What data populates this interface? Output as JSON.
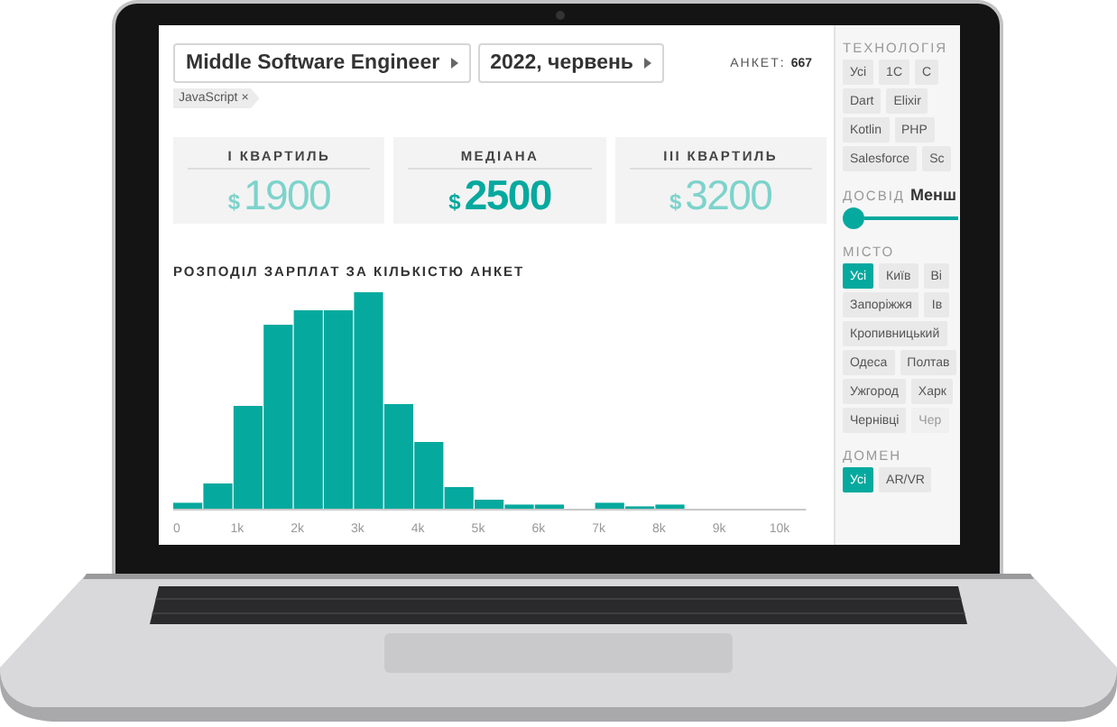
{
  "filters": [
    {
      "label": "Middle Software Engineer"
    },
    {
      "label": "2022, червень"
    }
  ],
  "count": {
    "label": "АНКЕТ:",
    "value": "667"
  },
  "tags": [
    {
      "label": "JavaScript",
      "remove": "×"
    }
  ],
  "stats": [
    {
      "label": "I КВАРТИЛЬ",
      "currency": "$",
      "value": "1900",
      "highlight": false
    },
    {
      "label": "МЕДІАНА",
      "currency": "$",
      "value": "2500",
      "highlight": true
    },
    {
      "label": "III КВАРТИЛЬ",
      "currency": "$",
      "value": "3200",
      "highlight": false
    }
  ],
  "chart": {
    "title": "РОЗПОДІЛ ЗАРПЛАТ ЗА КІЛЬКІСТЮ АНКЕТ",
    "x_ticks": [
      "0",
      "1k",
      "2k",
      "3k",
      "4k",
      "5k",
      "6k",
      "7k",
      "8k",
      "9k",
      "10k"
    ]
  },
  "sidebar": {
    "sections": [
      {
        "kind": "chips",
        "title": "ТЕХНОЛОГІЯ",
        "rows": [
          [
            {
              "label": "Усі",
              "selected": false,
              "disabled": false
            },
            {
              "label": "1С",
              "selected": false,
              "disabled": false
            },
            {
              "label": "C",
              "selected": false,
              "disabled": false
            }
          ],
          [
            {
              "label": "Dart",
              "selected": false,
              "disabled": false
            },
            {
              "label": "Elixir",
              "selected": false,
              "disabled": false
            }
          ],
          [
            {
              "label": "Kotlin",
              "selected": false,
              "disabled": false
            },
            {
              "label": "PHP",
              "selected": false,
              "disabled": false
            }
          ],
          [
            {
              "label": "Salesforce",
              "selected": false,
              "disabled": false
            },
            {
              "label": "Sc",
              "selected": false,
              "disabled": false
            }
          ]
        ]
      },
      {
        "kind": "slider",
        "title": "ДОСВІД",
        "value": "Менш",
        "level": 0
      },
      {
        "kind": "chips",
        "title": "МІСТО",
        "rows": [
          [
            {
              "label": "Усі",
              "selected": true,
              "disabled": false
            },
            {
              "label": "Київ",
              "selected": false,
              "disabled": false
            },
            {
              "label": "Ві",
              "selected": false,
              "disabled": false
            }
          ],
          [
            {
              "label": "Запоріжжя",
              "selected": false,
              "disabled": false
            },
            {
              "label": "Ів",
              "selected": false,
              "disabled": false
            }
          ],
          [
            {
              "label": "Кропивницький",
              "selected": false,
              "disabled": false
            }
          ],
          [
            {
              "label": "Одеса",
              "selected": false,
              "disabled": false
            },
            {
              "label": "Полтав",
              "selected": false,
              "disabled": false
            }
          ],
          [
            {
              "label": "Ужгород",
              "selected": false,
              "disabled": false
            },
            {
              "label": "Харк",
              "selected": false,
              "disabled": false
            }
          ],
          [
            {
              "label": "Чернівці",
              "selected": false,
              "disabled": false
            },
            {
              "label": "Чер",
              "selected": false,
              "disabled": true
            }
          ]
        ]
      },
      {
        "kind": "chips",
        "title": "ДОМЕН",
        "rows": [
          [
            {
              "label": "Усі",
              "selected": true,
              "disabled": false
            },
            {
              "label": "AR/VR",
              "selected": false,
              "disabled": false
            }
          ]
        ]
      }
    ]
  }
}
